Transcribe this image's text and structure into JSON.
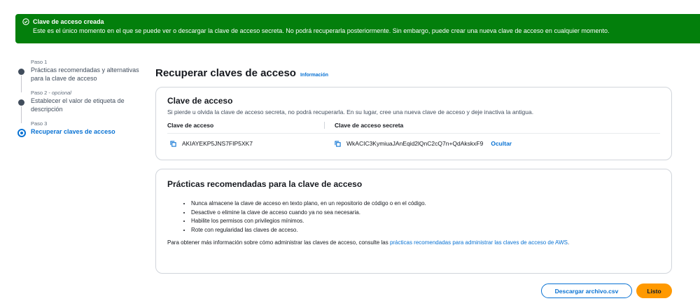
{
  "banner": {
    "title": "Clave de acceso creada",
    "message": "Este es el único momento en el que se puede ver o descargar la clave de acceso secreta. No podrá recuperarla posteriormente. Sin embargo, puede crear una nueva clave de acceso en cualquier momento."
  },
  "steps": [
    {
      "num": "Paso 1",
      "optional": "",
      "title": "Prácticas recomendadas y alternativas para la clave de acceso"
    },
    {
      "num": "Paso 2 - ",
      "optional": "opcional",
      "title": "Establecer el valor de etiqueta de descripción"
    },
    {
      "num": "Paso 3",
      "optional": "",
      "title": "Recuperar claves de acceso"
    }
  ],
  "page": {
    "title": "Recuperar claves de acceso",
    "info": "Información"
  },
  "access_key_card": {
    "title": "Clave de acceso",
    "subtitle": "Si pierde u olvida la clave de acceso secreta, no podrá recuperarla. En su lugar, cree una nueva clave de acceso y deje inactiva la antigua.",
    "col_access_key": "Clave de acceso",
    "col_secret_key": "Clave de acceso secreta",
    "access_key": "AKIAYEKP5JNS7FIP5XK7",
    "secret_key": "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",
    "hide_label": "Ocultar"
  },
  "best_practices_card": {
    "title": "Prácticas recomendadas para la clave de acceso",
    "bullets": [
      "Nunca almacene la clave de acceso en texto plano, en un repositorio de código o en el código.",
      "Desactive o elimine la clave de acceso cuando ya no sea necesaria.",
      "Habilite los permisos con privilegios mínimos.",
      "Rote con regularidad las claves de acceso."
    ],
    "footer_text": "Para obtener más información sobre cómo administrar las claves de acceso, consulte las ",
    "footer_link": "prácticas recomendadas para administrar las claves de acceso de AWS",
    "footer_end": "."
  },
  "buttons": {
    "download": "Descargar archivo.csv",
    "done": "Listo"
  },
  "colors": {
    "success": "#037f0c",
    "link": "#0972d3",
    "primary": "#ff9900"
  }
}
